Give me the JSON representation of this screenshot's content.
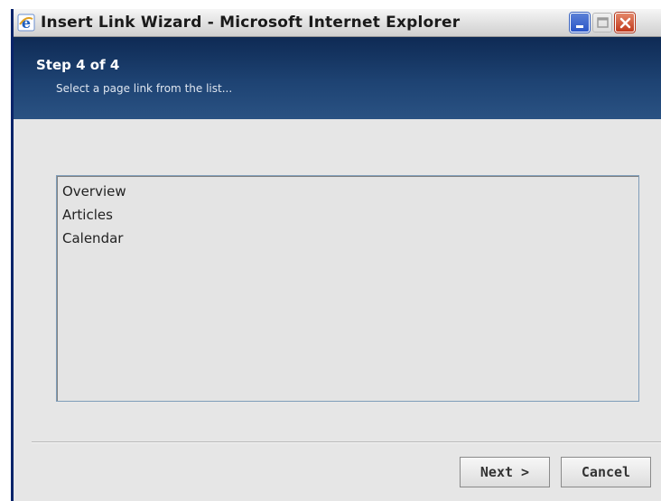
{
  "window": {
    "title": "Insert Link Wizard - Microsoft Internet Explorer"
  },
  "header": {
    "step": "Step 4 of 4",
    "instruction": "Select a page link from the list..."
  },
  "page_list": {
    "items": [
      "Overview",
      "Articles",
      "Calendar"
    ]
  },
  "buttons": {
    "next": "Next >",
    "cancel": "Cancel"
  },
  "colors": {
    "header_top": "#0e2a54",
    "header_bottom": "#2a5283",
    "window_bg": "#e6e6e6"
  },
  "icons": {
    "app": "internet-explorer-icon",
    "minimize": "minimize-icon",
    "maximize": "maximize-icon",
    "close": "close-icon"
  }
}
